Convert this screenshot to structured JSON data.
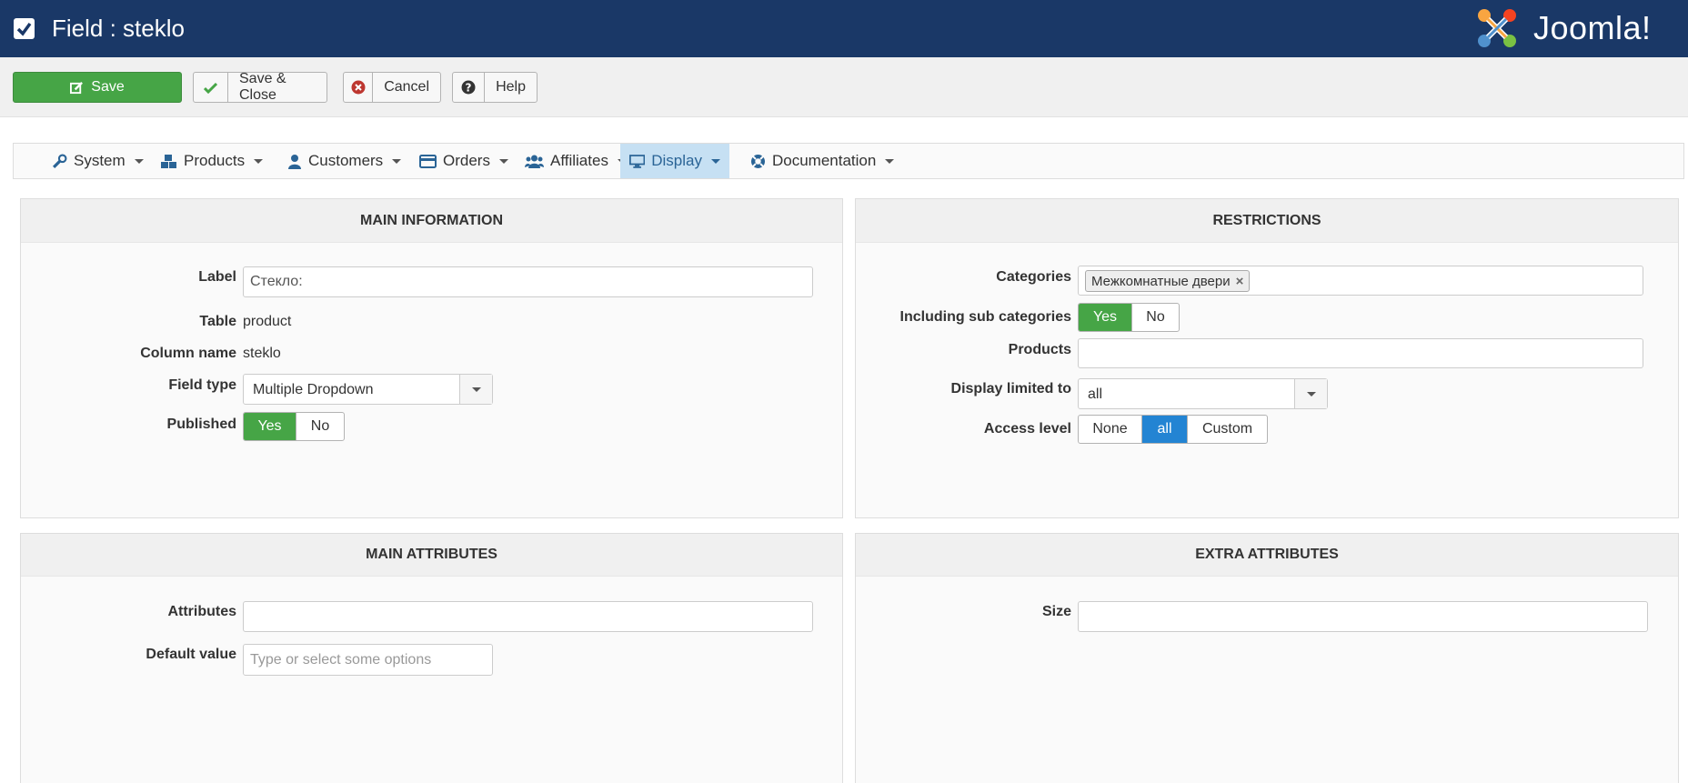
{
  "header": {
    "title": "Field : steklo",
    "brand": "Joomla!"
  },
  "toolbar": {
    "save": "Save",
    "save_close": "Save & Close",
    "cancel": "Cancel",
    "help": "Help"
  },
  "submenu": [
    {
      "label": "System",
      "icon": "wrench-icon"
    },
    {
      "label": "Products",
      "icon": "cubes-icon"
    },
    {
      "label": "Customers",
      "icon": "user-icon"
    },
    {
      "label": "Orders",
      "icon": "credit-card-icon"
    },
    {
      "label": "Affiliates",
      "icon": "users-icon"
    },
    {
      "label": "Display",
      "icon": "desktop-icon",
      "active": true
    },
    {
      "label": "Documentation",
      "icon": "life-ring-icon"
    }
  ],
  "main_information": {
    "heading": "MAIN INFORMATION",
    "label_label": "Label",
    "label_value": "Стекло:",
    "table_label": "Table",
    "table_value": "product",
    "column_label": "Column name",
    "column_value": "steklo",
    "field_type_label": "Field type",
    "field_type_value": "Multiple Dropdown",
    "published_label": "Published",
    "yes": "Yes",
    "no": "No"
  },
  "restrictions": {
    "heading": "RESTRICTIONS",
    "categories_label": "Categories",
    "category_chip": "Межкомнатные двери",
    "sub_label": "Including sub categories",
    "yes": "Yes",
    "no": "No",
    "products_label": "Products",
    "display_limited_label": "Display limited to",
    "display_limited_value": "all",
    "access_label": "Access level",
    "access_none": "None",
    "access_all": "all",
    "access_custom": "Custom"
  },
  "main_attributes": {
    "heading": "MAIN ATTRIBUTES",
    "attributes_label": "Attributes",
    "default_label": "Default value",
    "default_placeholder": "Type or select some options"
  },
  "extra_attributes": {
    "heading": "EXTRA ATTRIBUTES",
    "size_label": "Size"
  },
  "colors": {
    "header_bg": "#1a3867",
    "save_green": "#46a546",
    "toggle_blue": "#2384d3"
  }
}
